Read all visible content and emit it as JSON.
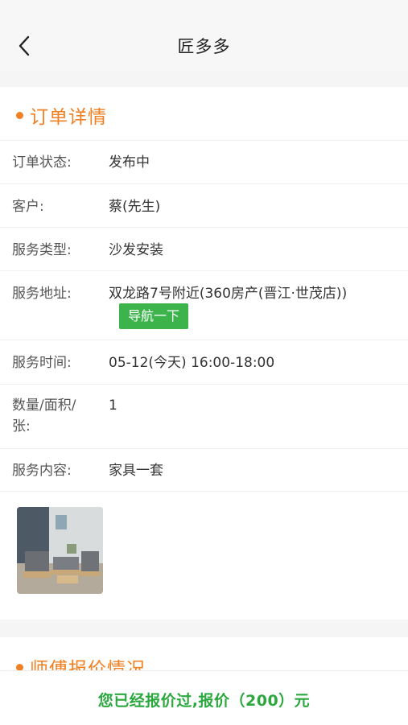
{
  "nav": {
    "title": "匠多多"
  },
  "detail": {
    "title": "订单详情",
    "rows": [
      {
        "label": "订单状态:",
        "value": "发布中"
      },
      {
        "label": "客户:",
        "value": "蔡(先生)"
      },
      {
        "label": "服务类型:",
        "value": "沙发安装"
      },
      {
        "label": "服务地址:",
        "value": "双龙路7号附近(360房产(晋江·世茂店))"
      },
      {
        "label": "服务时间:",
        "value": "05-12(今天) 16:00-18:00"
      },
      {
        "label": "数量/面积/张:",
        "value": "1"
      },
      {
        "label": "服务内容:",
        "value": "家具一套"
      }
    ],
    "navigate_label": "导航一下"
  },
  "quotes": {
    "title": "师傅报价情况"
  },
  "bottom": {
    "status_text": "您已经报价过,报价（200）元"
  },
  "colors": {
    "accent": "#f08023",
    "green": "#3cb44b",
    "green_text": "#2aa83d"
  }
}
